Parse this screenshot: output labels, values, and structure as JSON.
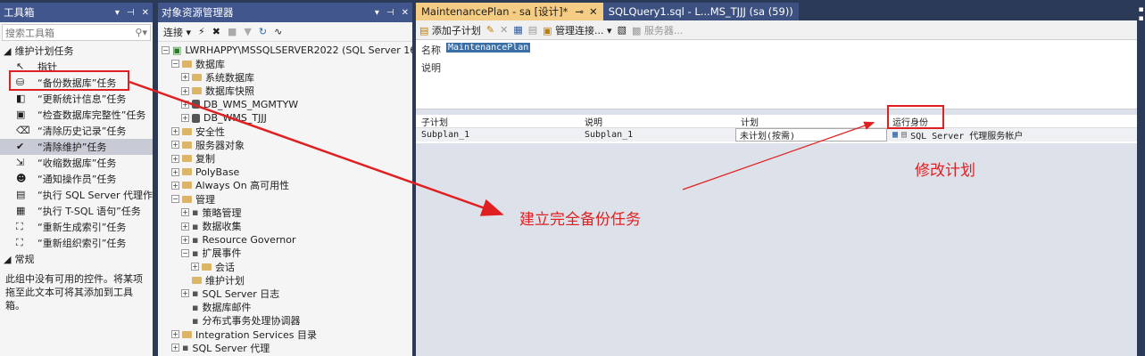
{
  "toolbox": {
    "title": "工具箱",
    "controls": [
      "▾",
      "ᵖ",
      "✕"
    ],
    "search_placeholder": "搜索工具箱",
    "group1": "维护计划任务",
    "items": [
      {
        "label": "指针",
        "icon": "pointer-icon"
      },
      {
        "label": "“备份数据库”任务",
        "icon": "backup-db-icon"
      },
      {
        "label": "“更新统计信息”任务",
        "icon": "update-stats-icon"
      },
      {
        "label": "“检查数据库完整性”任务",
        "icon": "check-integrity-icon"
      },
      {
        "label": "“清除历史记录”任务",
        "icon": "history-cleanup-icon"
      },
      {
        "label": "“清除维护”任务",
        "icon": "cleanup-icon"
      },
      {
        "label": "“收缩数据库”任务",
        "icon": "shrink-db-icon"
      },
      {
        "label": "“通知操作员”任务",
        "icon": "notify-operator-icon"
      },
      {
        "label": "“执行 SQL Server 代理作...",
        "icon": "agent-job-icon"
      },
      {
        "label": "“执行 T-SQL 语句”任务",
        "icon": "tsql-icon"
      },
      {
        "label": "“重新生成索引”任务",
        "icon": "rebuild-index-icon"
      },
      {
        "label": "“重新组织索引”任务",
        "icon": "reorganize-index-icon"
      }
    ],
    "group2": "常规",
    "note": "此组中没有可用的控件。将某项拖至此文本可将其添加到工具箱。"
  },
  "object_explorer": {
    "title": "对象资源管理器",
    "connect_label": "连接 ▾",
    "server": "LWRHAPPY\\MSSQLSERVER2022 (SQL Server 16.0.1",
    "nodes": [
      {
        "indent": 1,
        "exp": "−",
        "kind": "folder",
        "label": "数据库"
      },
      {
        "indent": 2,
        "exp": "+",
        "kind": "folder",
        "label": "系统数据库"
      },
      {
        "indent": 2,
        "exp": "+",
        "kind": "folder",
        "label": "数据库快照"
      },
      {
        "indent": 2,
        "exp": "+",
        "kind": "db",
        "label": "DB_WMS_MGMTYW"
      },
      {
        "indent": 2,
        "exp": "+",
        "kind": "db",
        "label": "DB_WMS_TJJJ"
      },
      {
        "indent": 1,
        "exp": "+",
        "kind": "folder",
        "label": "安全性"
      },
      {
        "indent": 1,
        "exp": "+",
        "kind": "folder",
        "label": "服务器对象"
      },
      {
        "indent": 1,
        "exp": "+",
        "kind": "folder",
        "label": "复制"
      },
      {
        "indent": 1,
        "exp": "+",
        "kind": "folder",
        "label": "PolyBase"
      },
      {
        "indent": 1,
        "exp": "+",
        "kind": "folder",
        "label": "Always On 高可用性"
      },
      {
        "indent": 1,
        "exp": "−",
        "kind": "folder",
        "label": "管理"
      },
      {
        "indent": 2,
        "exp": "+",
        "kind": "item",
        "label": "策略管理"
      },
      {
        "indent": 2,
        "exp": "+",
        "kind": "item",
        "label": "数据收集"
      },
      {
        "indent": 2,
        "exp": "+",
        "kind": "item",
        "label": "Resource Governor"
      },
      {
        "indent": 2,
        "exp": "−",
        "kind": "item",
        "label": "扩展事件"
      },
      {
        "indent": 3,
        "exp": "+",
        "kind": "folder",
        "label": "会话"
      },
      {
        "indent": 2,
        "exp": "",
        "kind": "folder",
        "label": "维护计划"
      },
      {
        "indent": 2,
        "exp": "+",
        "kind": "item",
        "label": "SQL Server 日志"
      },
      {
        "indent": 2,
        "exp": "",
        "kind": "item",
        "label": "数据库邮件"
      },
      {
        "indent": 2,
        "exp": "",
        "kind": "item",
        "label": "分布式事务处理协调器"
      },
      {
        "indent": 1,
        "exp": "+",
        "kind": "folder",
        "label": "Integration Services 目录"
      },
      {
        "indent": 1,
        "exp": "+",
        "kind": "item",
        "label": "SQL Server 代理"
      }
    ]
  },
  "document": {
    "tabs": [
      {
        "label": "MaintenancePlan - sa [设计]*",
        "active": true
      },
      {
        "label": "SQLQuery1.sql - L...MS_TJJJ (sa (59))",
        "active": false
      }
    ],
    "toolbar": {
      "add_subplan": "添加子计划",
      "manage_connections": "管理连接...",
      "servers": "服务器..."
    },
    "name_label": "名称",
    "name_value": "MaintenancePlan",
    "desc_label": "说明",
    "grid_headers": [
      "子计划",
      "说明",
      "计划",
      "运行身份"
    ],
    "grid_row": [
      "Subplan_1",
      "Subplan_1",
      "未计划(按需)",
      "SQL Server 代理服务帐户"
    ]
  },
  "annotations": {
    "create_backup": "建立完全备份任务",
    "modify_schedule": "修改计划"
  },
  "colors": {
    "accent": "#e02020",
    "title_bar": "#40568d",
    "active_tab": "#f5cc84"
  }
}
